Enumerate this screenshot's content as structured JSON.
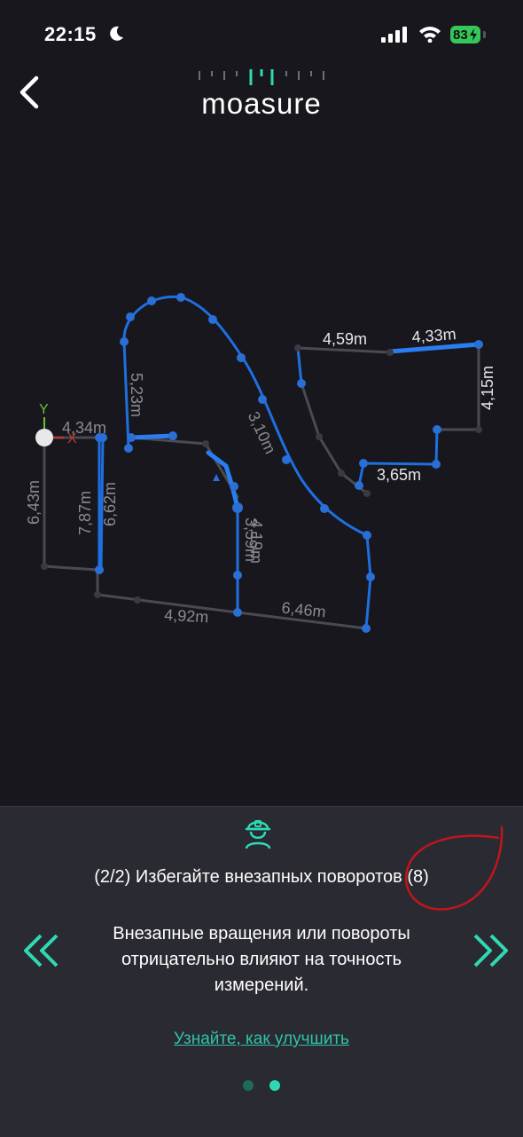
{
  "status_bar": {
    "time": "22:15",
    "battery": "83"
  },
  "header": {
    "logo_text": "moasure",
    "back_icon": "chevron-left-icon"
  },
  "plan": {
    "axis_y": "Y",
    "axis_x": "X",
    "labels": [
      "4,34m",
      "6,43m",
      "7,87m",
      "6,62m",
      "5,23m",
      "3,10m",
      "4,92m",
      "6,46m",
      "3,59m",
      "4,19m",
      "4,59m",
      "4,33m",
      "4,15m",
      "3,65m"
    ]
  },
  "tip": {
    "icon": "engineer-icon",
    "title": "(2/2) Избегайте внезапных поворотов (8)",
    "body": "Внезапные вращения или повороты отрицательно влияют на точность измерений.",
    "link": "Узнайте, как улучшить",
    "prev_icon": "double-chevron-left-icon",
    "next_icon": "double-chevron-right-icon"
  },
  "pagination": {
    "current": 2,
    "total": 2
  },
  "colors": {
    "accent": "#2ed9b3",
    "path": "#1f6fe0",
    "background": "#17171d",
    "panel": "#2a2a32"
  }
}
